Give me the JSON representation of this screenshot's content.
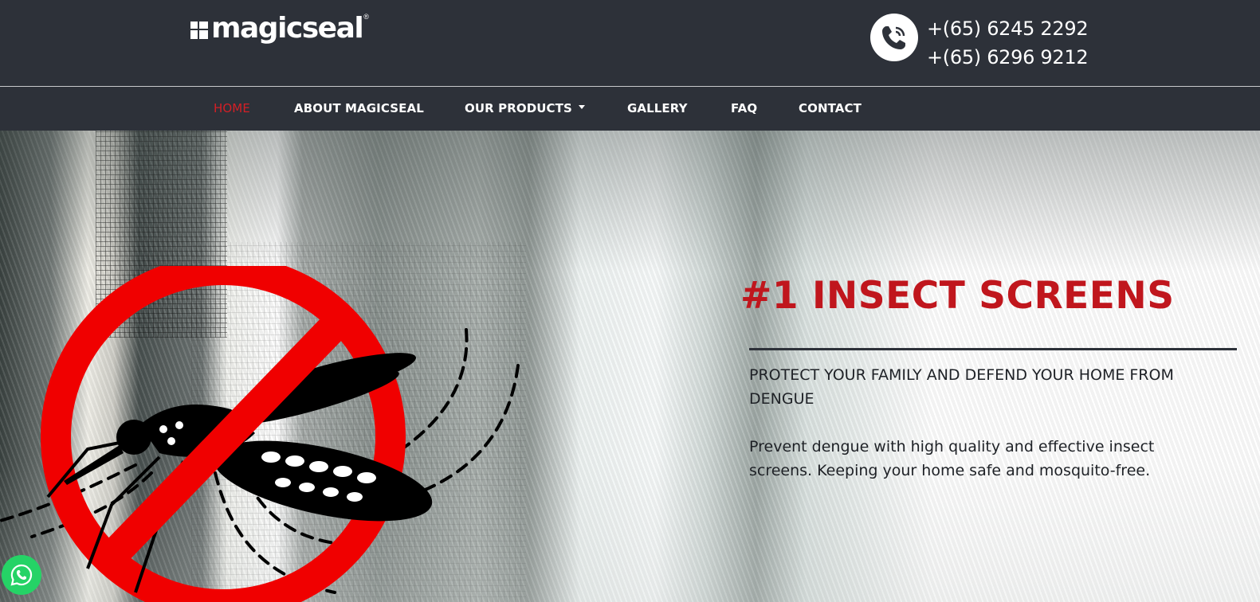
{
  "header": {
    "logo_text": "magicseal",
    "logo_reg": "®",
    "phones": [
      "+(65) 6245 2292",
      "+(65) 6296 9212"
    ]
  },
  "nav": {
    "items": [
      {
        "label": "HOME",
        "active": true
      },
      {
        "label": "ABOUT MAGICSEAL"
      },
      {
        "label": "OUR PRODUCTS",
        "dropdown": true
      },
      {
        "label": "GALLERY"
      },
      {
        "label": "FAQ"
      },
      {
        "label": "CONTACT"
      }
    ]
  },
  "hero": {
    "title": "#1 INSECT SCREENS",
    "subtitle": "PROTECT YOUR FAMILY AND DEFEND YOUR HOME FROM DENGUE",
    "body": "Prevent dengue with high quality and effective insect screens. Keeping your home safe and mosquito-free.",
    "image_icon": "no-mosquito-icon"
  },
  "colors": {
    "header_bg": "#2d3139",
    "accent_red": "#c0161d",
    "active_nav": "#d31f26",
    "whatsapp_green": "#25d366"
  },
  "icons": {
    "phone": "phone-icon",
    "whatsapp": "whatsapp-icon"
  }
}
